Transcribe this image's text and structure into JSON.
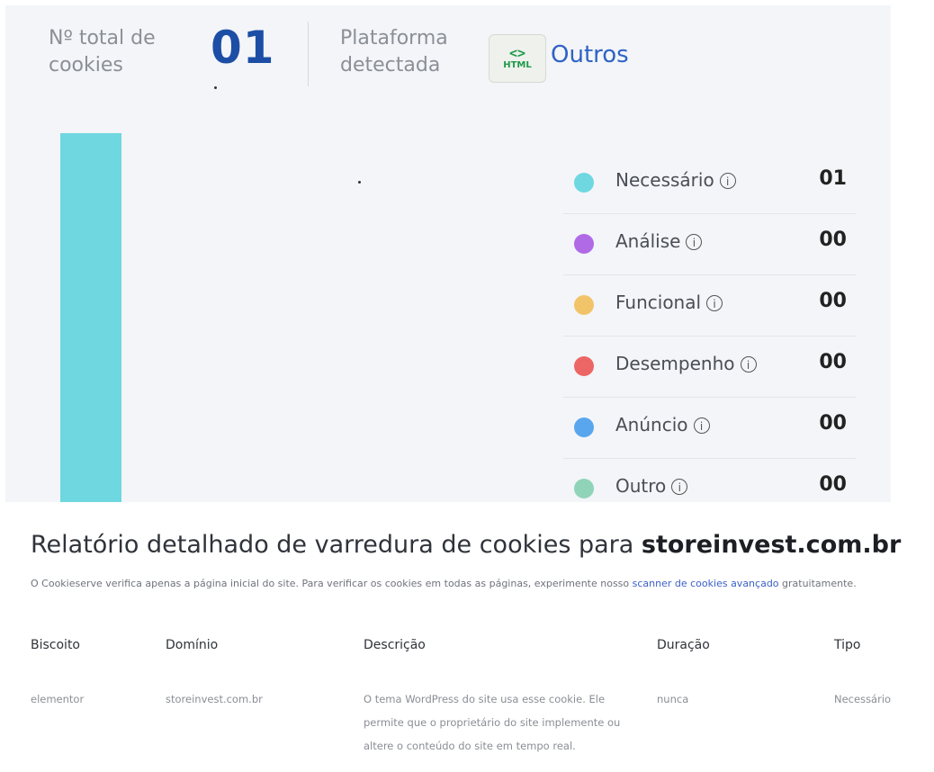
{
  "summary": {
    "total_label_line1": "Nº total de",
    "total_label_line2": "cookies",
    "total_value": "01",
    "platform_label_line1": "Plataforma",
    "platform_label_line2": "detectada",
    "platform_icon_code": "<>",
    "platform_icon_text": "HTML",
    "platform_value": "Outros"
  },
  "chart_data": {
    "type": "bar",
    "categories": [
      "Necessário",
      "Análise",
      "Funcional",
      "Desempenho",
      "Anúncio",
      "Outro"
    ],
    "values": [
      1,
      0,
      0,
      0,
      0,
      0
    ],
    "colors": [
      "#6fd7e0",
      "#b06ae6",
      "#f2c46a",
      "#ec6666",
      "#5aa6ee",
      "#8fd4b8"
    ]
  },
  "legend": [
    {
      "label": "Necessário",
      "count": "01",
      "color": "#6fd7e0",
      "info_icon": "i"
    },
    {
      "label": "Análise",
      "count": "00",
      "color": "#b06ae6",
      "info_icon": "i"
    },
    {
      "label": "Funcional",
      "count": "00",
      "color": "#f2c46a",
      "info_icon": "i"
    },
    {
      "label": "Desempenho",
      "count": "00",
      "color": "#ec6666",
      "info_icon": "i"
    },
    {
      "label": "Anúncio",
      "count": "00",
      "color": "#5aa6ee",
      "info_icon": "i"
    },
    {
      "label": "Outro",
      "count": "00",
      "color": "#8fd4b8",
      "info_icon": "i"
    }
  ],
  "report": {
    "title_prefix": "Relatório detalhado de varredura de cookies para ",
    "title_domain": "storeinvest.com.br",
    "note_prefix": "O Cookieserve verifica apenas a página inicial do site. Para verificar os cookies em todas as páginas, experimente nosso ",
    "note_link": "scanner de cookies avançado",
    "note_suffix": " gratuitamente."
  },
  "table": {
    "headers": [
      "Biscoito",
      "Domínio",
      "Descrição",
      "Duração",
      "Tipo"
    ],
    "rows": [
      {
        "cookie": "elementor",
        "domain": "storeinvest.com.br",
        "description": "O tema WordPress do site usa esse cookie. Ele permite que o proprietário do site implemente ou altere o conteúdo do site em tempo real.",
        "duration": "nunca",
        "type": "Necessário"
      }
    ]
  }
}
